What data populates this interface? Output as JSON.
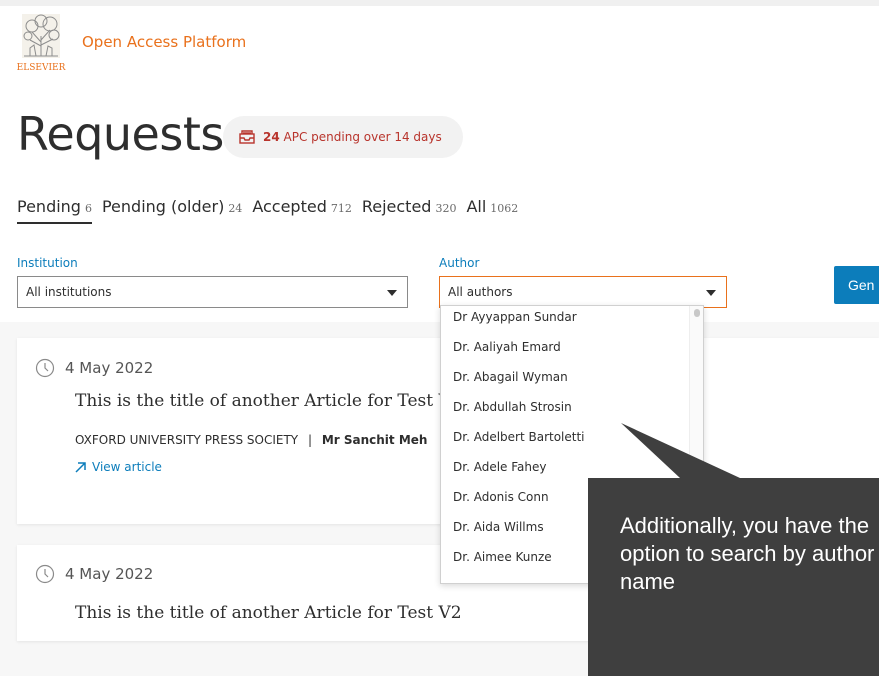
{
  "header": {
    "brand": "ELSEVIER",
    "app_title": "Open Access Platform"
  },
  "page": {
    "title": "Requests",
    "pending_badge": {
      "count": "24",
      "text": "APC pending over 14 days"
    }
  },
  "tabs": [
    {
      "label": "Pending",
      "count": "6",
      "active": true
    },
    {
      "label": "Pending (older)",
      "count": "24"
    },
    {
      "label": "Accepted",
      "count": "712"
    },
    {
      "label": "Rejected",
      "count": "320"
    },
    {
      "label": "All",
      "count": "1062"
    }
  ],
  "filters": {
    "institution": {
      "label": "Institution",
      "value": "All institutions"
    },
    "author": {
      "label": "Author",
      "value": "All authors"
    },
    "button_label": "Gen"
  },
  "author_options": [
    "Dr Ayyappan Sundar",
    "Dr. Aaliyah Emard",
    "Dr. Abagail Wyman",
    "Dr. Abdullah Strosin",
    "Dr. Adelbert Bartoletti",
    "Dr. Adele Fahey",
    "Dr. Adonis Conn",
    "Dr. Aida Willms",
    "Dr. Aimee Kunze"
  ],
  "cards": [
    {
      "date": "4 May 2022",
      "title": "This is the title of another Article for Test V2",
      "publisher": "OXFORD UNIVERSITY PRESS SOCIETY",
      "separator": "|",
      "author": "Mr Sanchit Meh",
      "view_label": "View article"
    },
    {
      "date": "4 May 2022",
      "title": "This is the title of another Article for Test V2"
    }
  ],
  "callout": {
    "text": "Additionally, you have the option to search by author name"
  },
  "colors": {
    "accent_orange": "#e9711c",
    "link_blue": "#0c7dbb",
    "badge_red": "#b8342c",
    "callout_bg": "#3f3f3f"
  }
}
